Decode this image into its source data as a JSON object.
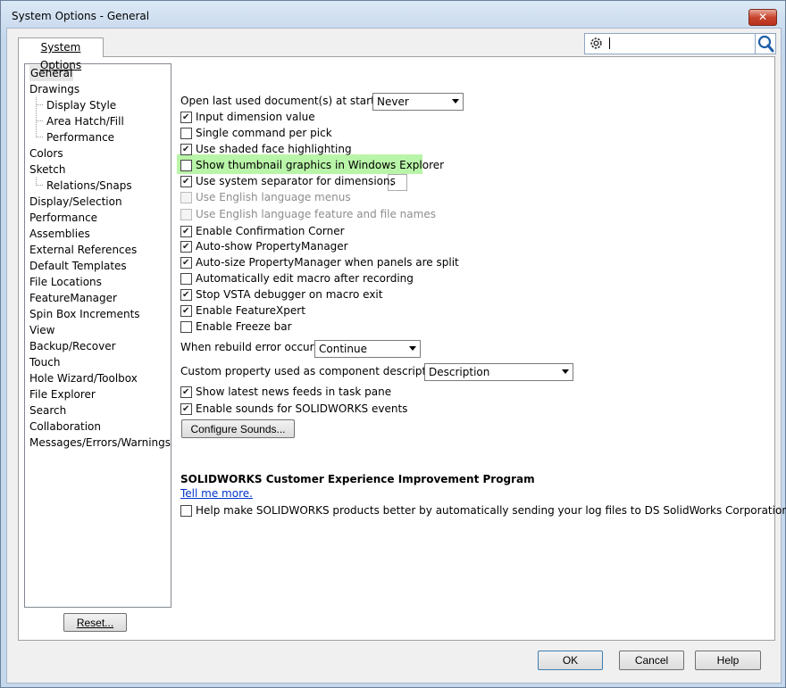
{
  "window": {
    "title": "System Options - General",
    "close_glyph": "✕"
  },
  "tab": {
    "label": "System Options"
  },
  "search": {
    "placeholder": ""
  },
  "nav": {
    "items": [
      {
        "label": "General",
        "sub": false,
        "selected": true
      },
      {
        "label": "Drawings",
        "sub": false
      },
      {
        "label": "Display Style",
        "sub": true
      },
      {
        "label": "Area Hatch/Fill",
        "sub": true
      },
      {
        "label": "Performance",
        "sub": true
      },
      {
        "label": "Colors",
        "sub": false
      },
      {
        "label": "Sketch",
        "sub": false
      },
      {
        "label": "Relations/Snaps",
        "sub": true
      },
      {
        "label": "Display/Selection",
        "sub": false
      },
      {
        "label": "Performance",
        "sub": false
      },
      {
        "label": "Assemblies",
        "sub": false
      },
      {
        "label": "External References",
        "sub": false
      },
      {
        "label": "Default Templates",
        "sub": false
      },
      {
        "label": "File Locations",
        "sub": false
      },
      {
        "label": "FeatureManager",
        "sub": false
      },
      {
        "label": "Spin Box Increments",
        "sub": false
      },
      {
        "label": "View",
        "sub": false
      },
      {
        "label": "Backup/Recover",
        "sub": false
      },
      {
        "label": "Touch",
        "sub": false
      },
      {
        "label": "Hole Wizard/Toolbox",
        "sub": false
      },
      {
        "label": "File Explorer",
        "sub": false
      },
      {
        "label": "Search",
        "sub": false
      },
      {
        "label": "Collaboration",
        "sub": false
      },
      {
        "label": "Messages/Errors/Warnings",
        "sub": false
      }
    ],
    "reset_label": "Reset..."
  },
  "general": {
    "open_last_label": "Open last used document(s) at startup:",
    "open_last_value": "Never",
    "options": [
      {
        "label": "Input dimension value",
        "checked": true,
        "disabled": false
      },
      {
        "label": "Single command per pick",
        "checked": false,
        "disabled": false
      },
      {
        "label": "Use shaded face highlighting",
        "checked": true,
        "disabled": false
      },
      {
        "label": "Show thumbnail graphics in Windows Explorer",
        "checked": false,
        "disabled": false,
        "highlighted": true
      },
      {
        "label": "Use system separator for dimensions",
        "checked": true,
        "disabled": false
      },
      {
        "label": "Use English language menus",
        "checked": false,
        "disabled": true
      },
      {
        "label": "Use English language feature and file names",
        "checked": false,
        "disabled": true
      },
      {
        "label": "Enable Confirmation Corner",
        "checked": true,
        "disabled": false
      },
      {
        "label": "Auto-show PropertyManager",
        "checked": true,
        "disabled": false
      },
      {
        "label": "Auto-size PropertyManager when panels are split",
        "checked": true,
        "disabled": false
      },
      {
        "label": "Automatically edit macro after recording",
        "checked": false,
        "disabled": false
      },
      {
        "label": "Stop VSTA debugger on macro exit",
        "checked": true,
        "disabled": false
      },
      {
        "label": "Enable FeatureXpert",
        "checked": true,
        "disabled": false
      },
      {
        "label": "Enable Freeze bar",
        "checked": false,
        "disabled": false
      }
    ],
    "separator_value": ".",
    "rebuild_label": "When rebuild error occurs:",
    "rebuild_value": "Continue",
    "custom_prop_label": "Custom property used as component description:",
    "custom_prop_value": "Description",
    "news_label": "Show latest news feeds in task pane",
    "news_checked": true,
    "sounds_label": "Enable sounds for SOLIDWORKS events",
    "sounds_checked": true,
    "configure_sounds_label": "Configure Sounds...",
    "ceip_title": "SOLIDWORKS Customer Experience Improvement Program",
    "ceip_link": "Tell me more.",
    "ceip_option": "Help make SOLIDWORKS products better by automatically sending your log files to DS SolidWorks Corporation",
    "ceip_checked": false
  },
  "footer": {
    "ok_label": "OK",
    "cancel_label": "Cancel",
    "help_label": "Help"
  },
  "colors": {
    "highlight": "#b9f5a8",
    "link": "#0033cc",
    "close_button": "#c7452e"
  }
}
